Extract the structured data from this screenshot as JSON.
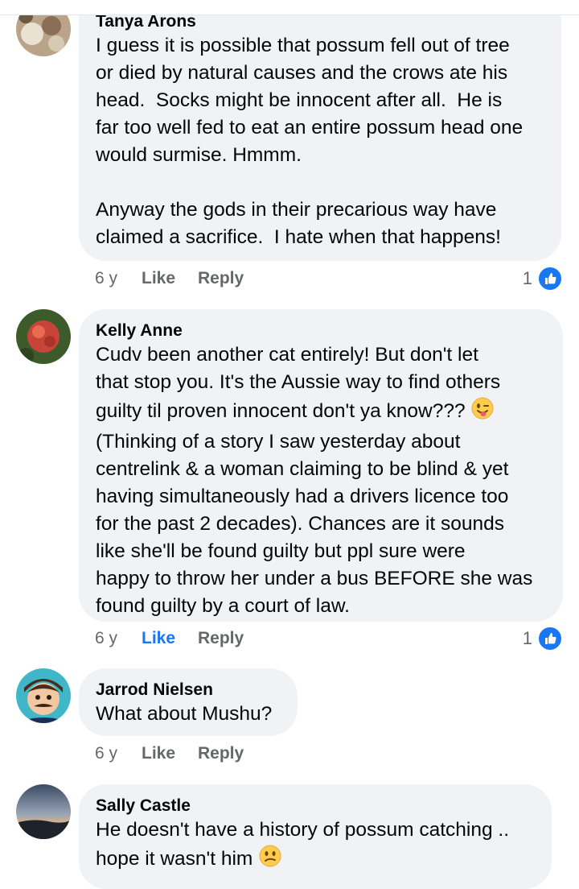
{
  "comments": [
    {
      "author": "Tanya Arons",
      "text": "I guess it is possible that possum fell out of tree\nor died by natural causes and the crows ate his\nhead.  Socks might be innocent after all.  He is\nfar too well fed to eat an entire possum head one\nwould surmise. Hmmm.\n\nAnyway the gods in their precarious way have\nclaimed a sacrifice.  I hate when that happens!",
      "time": "6 y",
      "like": "Like",
      "reply": "Reply",
      "reactions": "1"
    },
    {
      "author": "Kelly Anne",
      "text_a": "Cudv been another cat entirely! But don't let\nthat stop you. It's the Aussie way to find others\nguilty til proven innocent don't ya know??? ",
      "emoji": "winking-tongue-face",
      "text_b": "\n(Thinking of a story I saw yesterday about\ncentrelink & a woman claiming to be blind & yet\nhaving simultaneously had a drivers licence too\nfor the past 2 decades). Chances are it sounds\nlike she'll be found guilty but ppl sure were\nhappy to throw her under a bus BEFORE she was\nfound guilty by a court of law.",
      "time": "6 y",
      "like": "Like",
      "reply": "Reply",
      "reactions": "1",
      "liked": true
    },
    {
      "author": "Jarrod Nielsen",
      "text": "What about Mushu?",
      "time": "6 y",
      "like": "Like",
      "reply": "Reply"
    },
    {
      "author": "Sally Castle",
      "text": "He doesn't have a history of possum catching ..\nhope it wasn't him ",
      "emoji": "confused-face"
    }
  ],
  "colors": {
    "bubble": "#f0f2f5",
    "like_blue": "#1877f2",
    "meta_grey": "#65676b"
  }
}
